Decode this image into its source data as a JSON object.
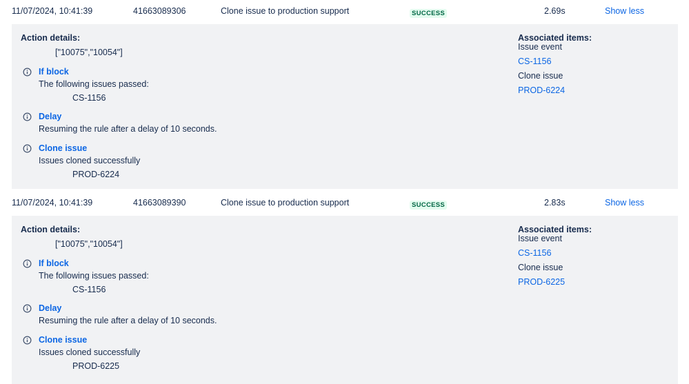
{
  "rows": [
    {
      "date": "11/07/2024, 10:41:39",
      "id": "41663089306",
      "rule_name": "Clone issue to production support",
      "status": "SUCCESS",
      "duration": "2.69s",
      "toggle_label": "Show less",
      "details": {
        "action_details_label": "Action details:",
        "action_value": "[\"10075\",\"10054\"]",
        "if_block": {
          "title": "If block",
          "text": "The following issues passed:",
          "item": "CS-1156"
        },
        "delay": {
          "title": "Delay",
          "text": "Resuming the rule after a delay of 10 seconds."
        },
        "clone": {
          "title": "Clone issue",
          "text": "Issues cloned successfully",
          "item": "PROD-6224"
        },
        "associated_label": "Associated items:",
        "assoc_event_label": "Issue event",
        "assoc_event_link": "CS-1156",
        "assoc_clone_label": "Clone issue",
        "assoc_clone_link": "PROD-6224"
      }
    },
    {
      "date": "11/07/2024, 10:41:39",
      "id": "41663089390",
      "rule_name": "Clone issue to production support",
      "status": "SUCCESS",
      "duration": "2.83s",
      "toggle_label": "Show less",
      "details": {
        "action_details_label": "Action details:",
        "action_value": "[\"10075\",\"10054\"]",
        "if_block": {
          "title": "If block",
          "text": "The following issues passed:",
          "item": "CS-1156"
        },
        "delay": {
          "title": "Delay",
          "text": "Resuming the rule after a delay of 10 seconds."
        },
        "clone": {
          "title": "Clone issue",
          "text": "Issues cloned successfully",
          "item": "PROD-6225"
        },
        "associated_label": "Associated items:",
        "assoc_event_label": "Issue event",
        "assoc_event_link": "CS-1156",
        "assoc_clone_label": "Clone issue",
        "assoc_clone_link": "PROD-6225"
      }
    }
  ],
  "icons": {
    "info": "info-circle-icon"
  },
  "colors": {
    "link": "#0c66e4",
    "success_bg": "#e3fcef",
    "success_text": "#006644",
    "panel_bg": "#f1f2f4"
  }
}
